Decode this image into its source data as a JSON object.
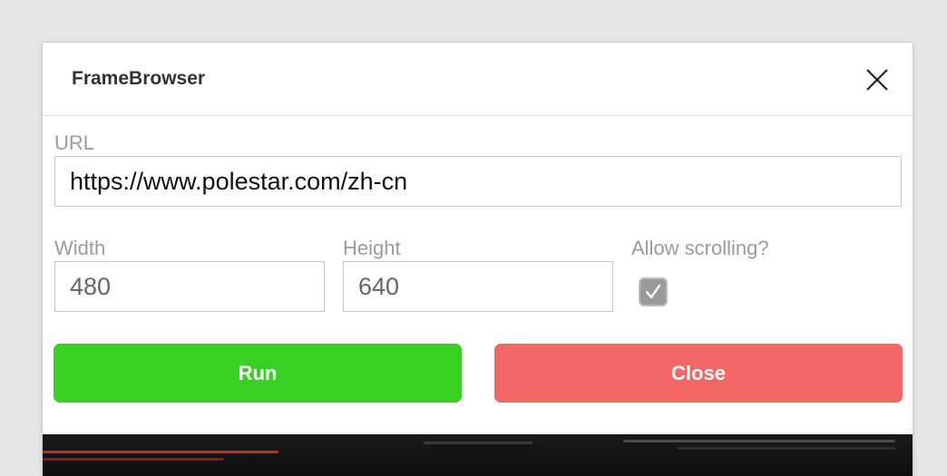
{
  "window": {
    "title": "FrameBrowser",
    "close_icon": "close-icon"
  },
  "form": {
    "url": {
      "label": "URL",
      "value": "https://www.polestar.com/zh-cn"
    },
    "width": {
      "label": "Width",
      "value": "480"
    },
    "height": {
      "label": "Height",
      "value": "640"
    },
    "allow_scrolling": {
      "label": "Allow scrolling?",
      "checked": true
    }
  },
  "buttons": {
    "run_label": "Run",
    "close_label": "Close"
  },
  "colors": {
    "run": "#38d123",
    "close": "#f26666",
    "label": "#9b9b9b"
  }
}
